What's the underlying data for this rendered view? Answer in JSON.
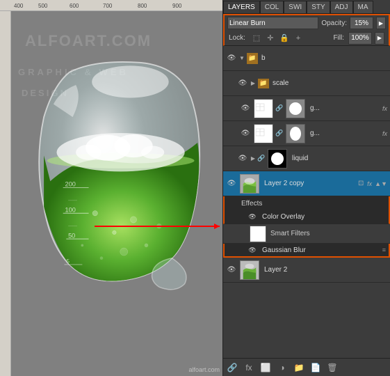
{
  "canvas": {
    "ruler_numbers_top": [
      "400",
      "500",
      "600",
      "700",
      "800",
      "900"
    ],
    "watermark_lines": [
      "ALFOART.COM",
      "GRAPHIC & WEB",
      "DESIGN"
    ]
  },
  "layers_panel": {
    "tabs": [
      "LAYERS",
      "COL",
      "SWI",
      "STY",
      "ADJ",
      "MA"
    ],
    "active_tab": "LAYERS",
    "blend_mode": "Linear Burn",
    "opacity_label": "Opacity:",
    "opacity_value": "15%",
    "lock_label": "Lock:",
    "fill_label": "Fill:",
    "fill_value": "100%",
    "layers": [
      {
        "id": "b",
        "name": "b",
        "type": "folder",
        "visible": true,
        "expanded": true
      },
      {
        "id": "scale",
        "name": "scale",
        "type": "folder",
        "visible": true,
        "indent": 1
      },
      {
        "id": "layer_g1",
        "name": "g...",
        "type": "layer",
        "visible": true,
        "has_fx": true,
        "indent": 1,
        "thumb": "white_blob"
      },
      {
        "id": "layer_g2",
        "name": "g...",
        "type": "layer",
        "visible": true,
        "has_fx": true,
        "indent": 1,
        "thumb": "white_blob2"
      },
      {
        "id": "liquid",
        "name": "liquid",
        "type": "folder",
        "visible": true,
        "indent": 1,
        "thumb": "black_blob"
      },
      {
        "id": "layer2copy",
        "name": "Layer 2 copy",
        "type": "layer",
        "visible": true,
        "selected": true,
        "has_fx": true,
        "thumb": "flask_green"
      },
      {
        "id": "effects_header",
        "name": "Effects",
        "type": "effects_group"
      },
      {
        "id": "color_overlay",
        "name": "Color Overlay",
        "type": "effect",
        "visible": true
      },
      {
        "id": "smart_filters",
        "name": "Smart Filters",
        "type": "smart_filters",
        "visible": false
      },
      {
        "id": "gaussian_blur",
        "name": "Gaussian Blur",
        "type": "effect",
        "visible": true
      },
      {
        "id": "layer2",
        "name": "Layer 2",
        "type": "layer",
        "visible": true,
        "thumb": "small_green"
      }
    ],
    "bottom_icons": [
      "link",
      "style",
      "mask",
      "adjustment",
      "group",
      "trash"
    ]
  },
  "site_label": "alfoart.com"
}
